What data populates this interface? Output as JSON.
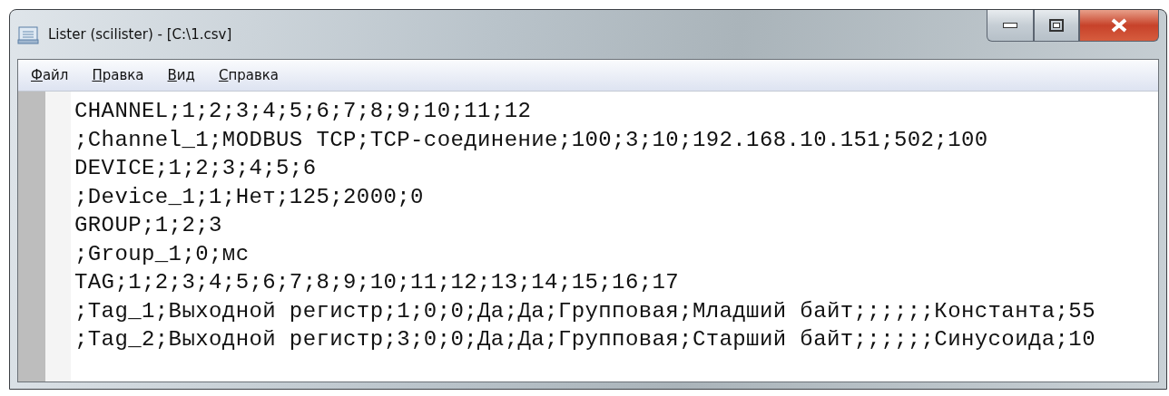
{
  "window": {
    "title": "Lister (scilister) - [C:\\1.csv]"
  },
  "menu": [
    {
      "label": "Файл"
    },
    {
      "label": "Правка"
    },
    {
      "label": "Вид"
    },
    {
      "label": "Справка"
    }
  ],
  "lines": [
    "CHANNEL;1;2;3;4;5;6;7;8;9;10;11;12",
    ";Channel_1;MODBUS TCP;TCP-соединение;100;3;10;192.168.10.151;502;100",
    "DEVICE;1;2;3;4;5;6",
    ";Device_1;1;Нет;125;2000;0",
    "GROUP;1;2;3",
    ";Group_1;0;мс",
    "TAG;1;2;3;4;5;6;7;8;9;10;11;12;13;14;15;16;17",
    ";Tag_1;Выходной регистр;1;0;0;Да;Да;Групповая;Младший байт;;;;;;Константа;55",
    ";Tag_2;Выходной регистр;3;0;0;Да;Да;Групповая;Старший байт;;;;;;Синусоида;10"
  ]
}
